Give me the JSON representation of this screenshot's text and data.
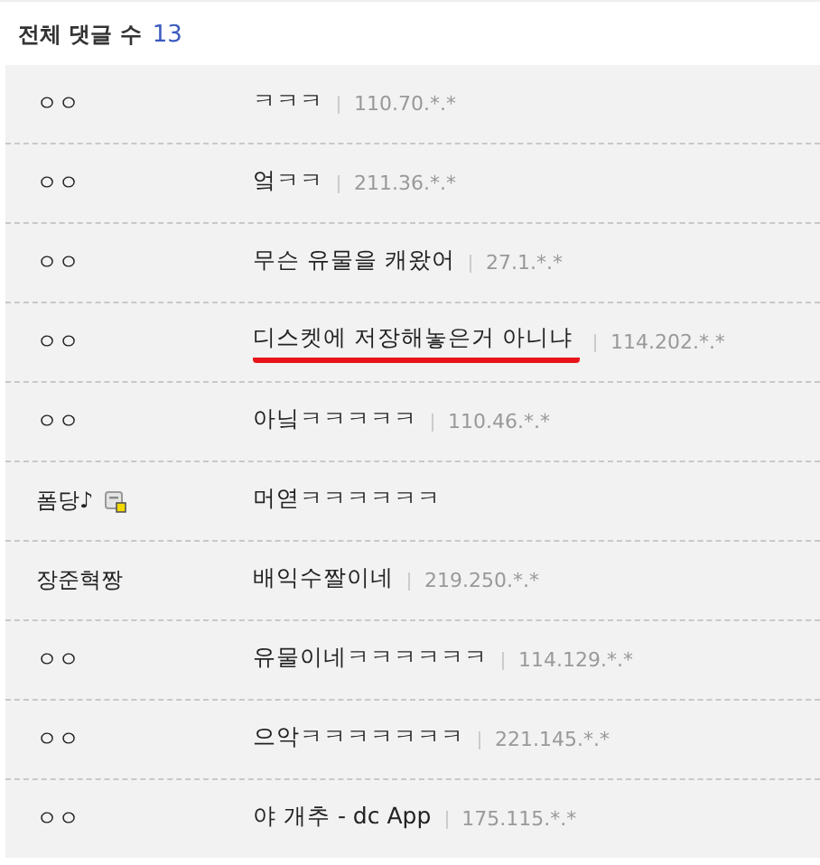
{
  "header": {
    "title": "전체 댓글 수",
    "count": "13"
  },
  "comments": [
    {
      "author": "ㅇㅇ",
      "author_icon": false,
      "text": "ㅋㅋㅋ",
      "ip": "110.70.*.*",
      "underlined": false
    },
    {
      "author": "ㅇㅇ",
      "author_icon": false,
      "text": "엌ㅋㅋ",
      "ip": "211.36.*.*",
      "underlined": false
    },
    {
      "author": "ㅇㅇ",
      "author_icon": false,
      "text": "무슨 유물을 캐왔어",
      "ip": "27.1.*.*",
      "underlined": false
    },
    {
      "author": "ㅇㅇ",
      "author_icon": false,
      "text": "디스켓에 저장해놓은거 아니냐",
      "ip": "114.202.*.*",
      "underlined": true
    },
    {
      "author": "ㅇㅇ",
      "author_icon": false,
      "text": "아닠ㅋㅋㅋㅋㅋ",
      "ip": "110.46.*.*",
      "underlined": false
    },
    {
      "author": "폼당♪",
      "author_icon": true,
      "text": "머엳ㅋㅋㅋㅋㅋㅋ",
      "underlined": false
    },
    {
      "author": "장준혁짱",
      "author_icon": false,
      "text": "배익수짤이네",
      "ip": "219.250.*.*",
      "underlined": false
    },
    {
      "author": "ㅇㅇ",
      "author_icon": false,
      "text": "유물이네ㅋㅋㅋㅋㅋㅋ",
      "ip": "114.129.*.*",
      "underlined": false
    },
    {
      "author": "ㅇㅇ",
      "author_icon": false,
      "text": "으악ㅋㅋㅋㅋㅋㅋㅋ",
      "ip": "221.145.*.*",
      "underlined": false
    },
    {
      "author": "ㅇㅇ",
      "author_icon": false,
      "text": "야 개추 - dc App",
      "ip": "175.115.*.*",
      "underlined": false
    }
  ]
}
